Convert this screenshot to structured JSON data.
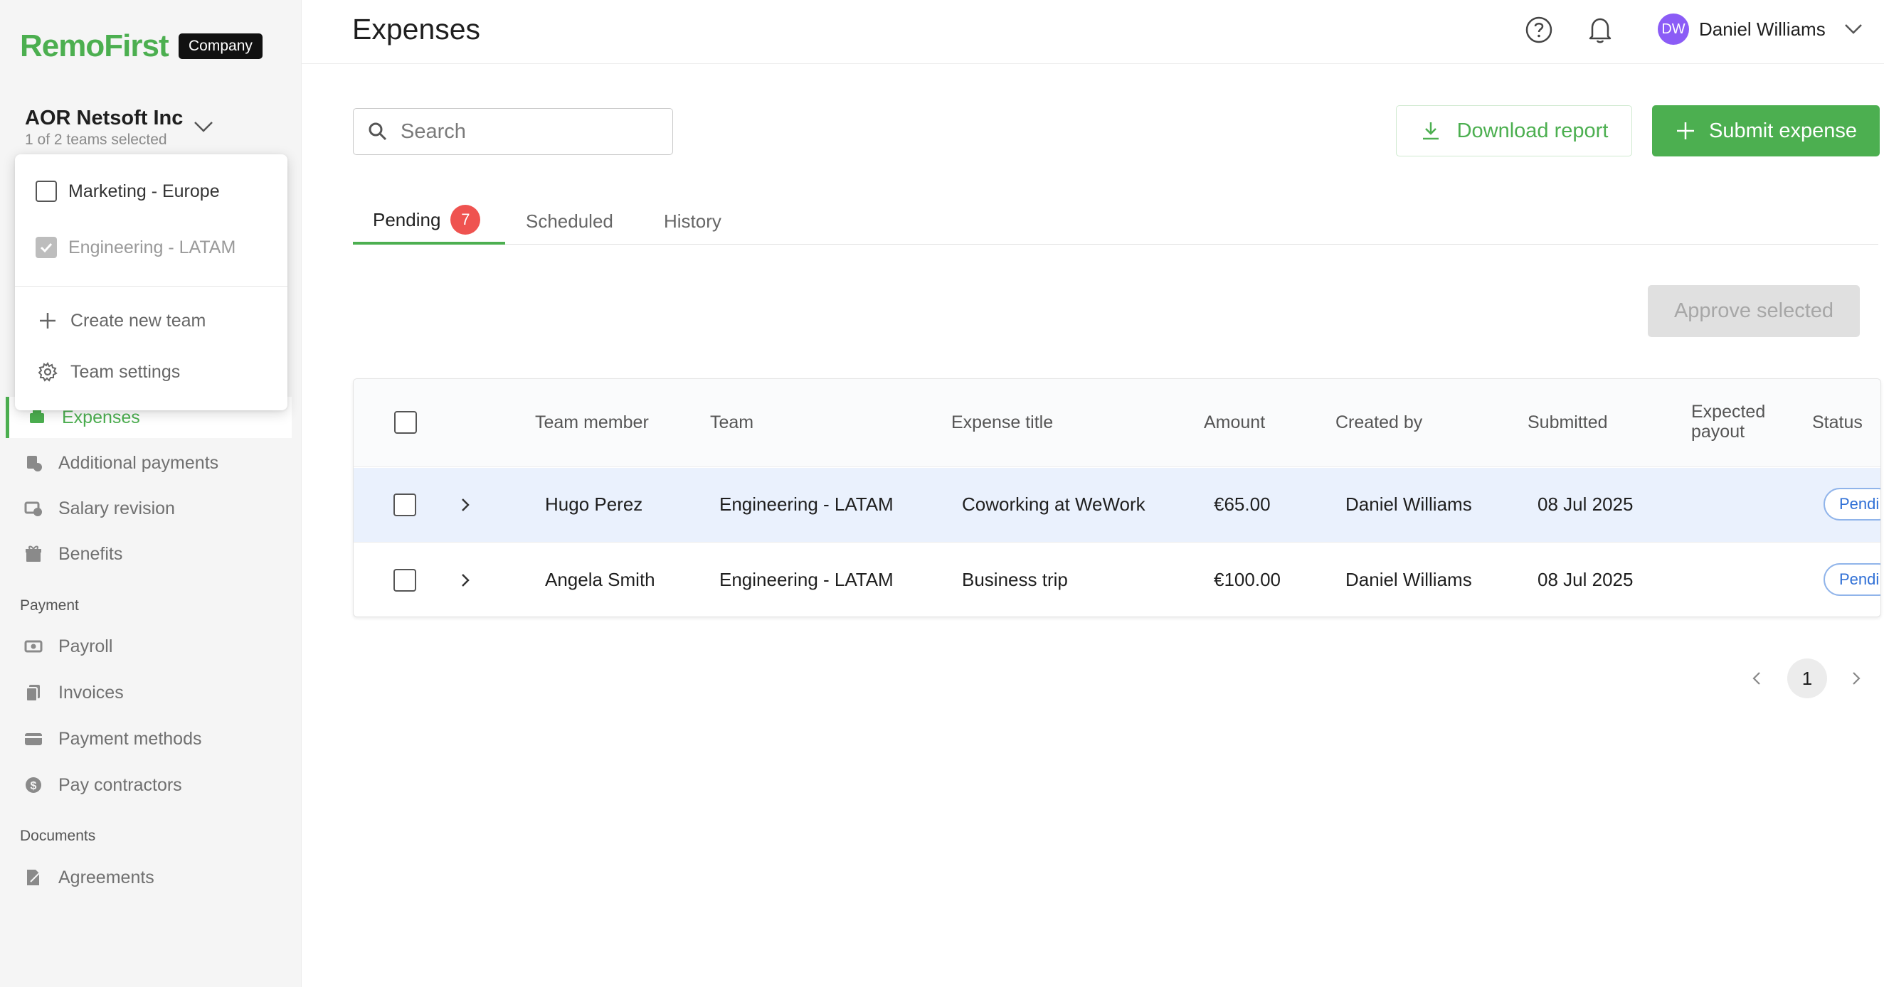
{
  "brand": {
    "logo": "RemoFirst",
    "badge": "Company",
    "accent": "#4caf50"
  },
  "org": {
    "name": "AOR Netsoft Inc",
    "subtitle": "1 of 2 teams selected"
  },
  "team_dropdown": {
    "teams": [
      {
        "label": "Marketing - Europe",
        "checked": false,
        "disabled": false
      },
      {
        "label": "Engineering - LATAM",
        "checked": true,
        "disabled": true
      }
    ],
    "actions": [
      {
        "label": "Create new team",
        "icon": "plus-icon"
      },
      {
        "label": "Team settings",
        "icon": "gear-icon"
      }
    ]
  },
  "sidebar": {
    "items": [
      {
        "label": "Expenses",
        "icon": "expenses-icon",
        "active": true
      },
      {
        "label": "Additional payments",
        "icon": "additional-payments-icon"
      },
      {
        "label": "Salary revision",
        "icon": "salary-revision-icon"
      },
      {
        "label": "Benefits",
        "icon": "gift-icon"
      }
    ],
    "payment_section": "Payment",
    "payment_items": [
      {
        "label": "Payroll",
        "icon": "payroll-icon"
      },
      {
        "label": "Invoices",
        "icon": "invoices-icon"
      },
      {
        "label": "Payment methods",
        "icon": "credit-card-icon"
      },
      {
        "label": "Pay contractors",
        "icon": "dollar-icon"
      }
    ],
    "documents_section": "Documents",
    "document_items": [
      {
        "label": "Agreements",
        "icon": "agreement-icon"
      }
    ]
  },
  "header": {
    "title": "Expenses",
    "user_initials": "DW",
    "user_name": "Daniel Williams"
  },
  "toolbar": {
    "search_placeholder": "Search",
    "download_label": "Download report",
    "submit_label": "Submit expense"
  },
  "tabs": [
    {
      "label": "Pending",
      "badge": "7",
      "active": true
    },
    {
      "label": "Scheduled"
    },
    {
      "label": "History"
    }
  ],
  "approve_label": "Approve selected",
  "table": {
    "columns": [
      "Team member",
      "Team",
      "Expense title",
      "Amount",
      "Created by",
      "Submitted",
      "Expected payout",
      "Status"
    ],
    "rows": [
      {
        "member": "Hugo Perez",
        "team": "Engineering - LATAM",
        "title": "Coworking at WeWork",
        "amount": "€65.00",
        "created_by": "Daniel Williams",
        "submitted": "08 Jul 2025",
        "payout": "",
        "status": "Pendi"
      },
      {
        "member": "Angela Smith",
        "team": "Engineering - LATAM",
        "title": "Business trip",
        "amount": "€100.00",
        "created_by": "Daniel Williams",
        "submitted": "08 Jul 2025",
        "payout": "",
        "status": "Pendi"
      }
    ]
  },
  "pagination": {
    "current": "1"
  }
}
